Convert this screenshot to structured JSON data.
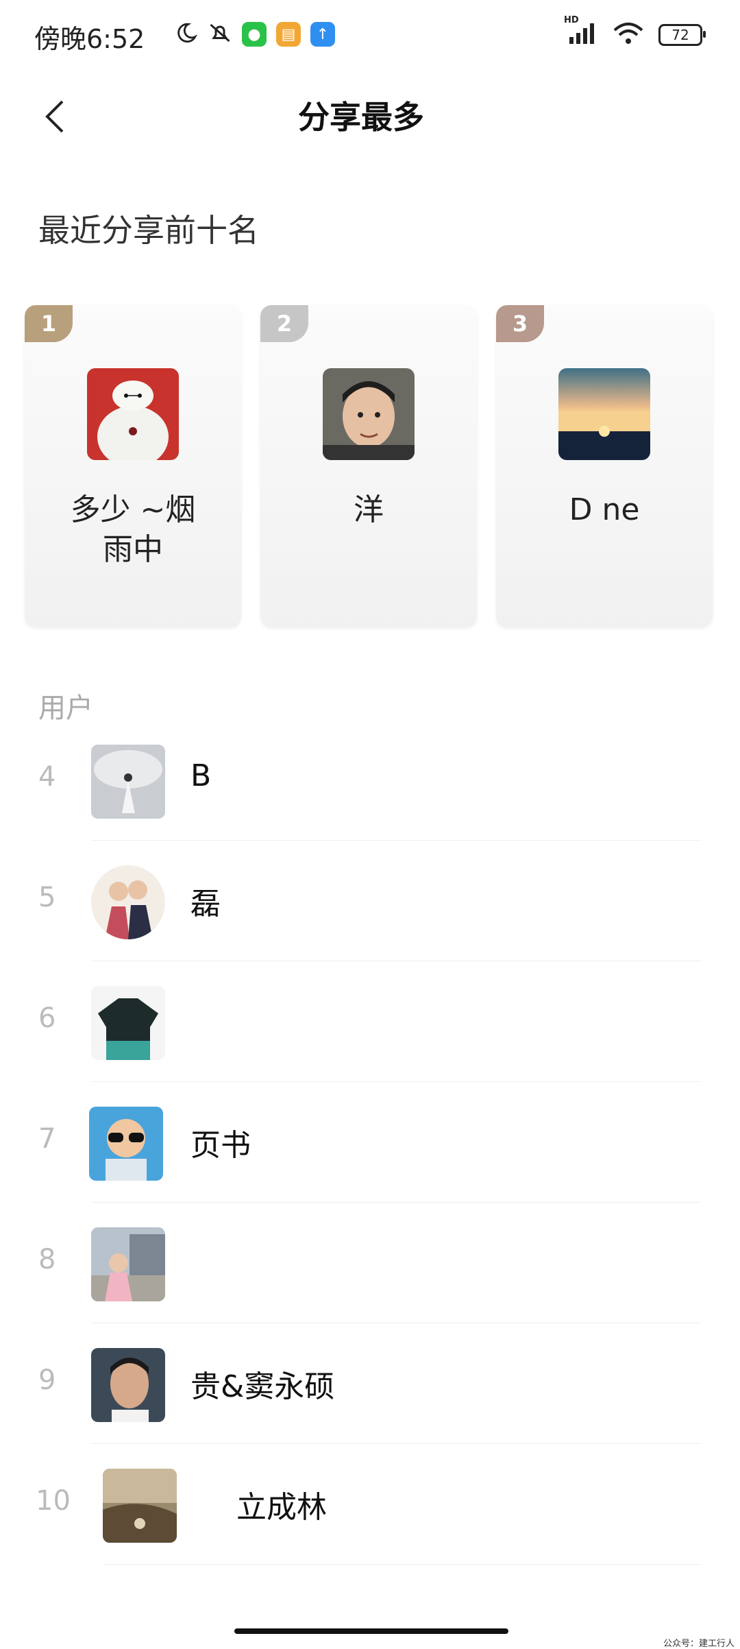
{
  "status_bar": {
    "time": "傍晚6:52",
    "battery": "72",
    "network": "HD"
  },
  "header": {
    "title": "分享最多",
    "back_icon": "chevron-left-icon"
  },
  "section_title": "最近分享前十名",
  "top_three": [
    {
      "rank": "1",
      "name": "多少 ~烟\n雨中",
      "badge_color": "#b8a07c"
    },
    {
      "rank": "2",
      "name": "洋",
      "badge_color": "#c6c6c6"
    },
    {
      "rank": "3",
      "name": "D ne",
      "badge_color": "#b79a8d"
    }
  ],
  "users_header": "用户",
  "users": [
    {
      "rank": "4",
      "name": "B"
    },
    {
      "rank": "5",
      "name": "磊"
    },
    {
      "rank": "6",
      "name": ""
    },
    {
      "rank": "7",
      "name": "页书"
    },
    {
      "rank": "8",
      "name": ""
    },
    {
      "rank": "9",
      "name": "贵&窦永硕"
    },
    {
      "rank": "10",
      "name": "立成林"
    }
  ],
  "watermark": "公众号：建工行人"
}
